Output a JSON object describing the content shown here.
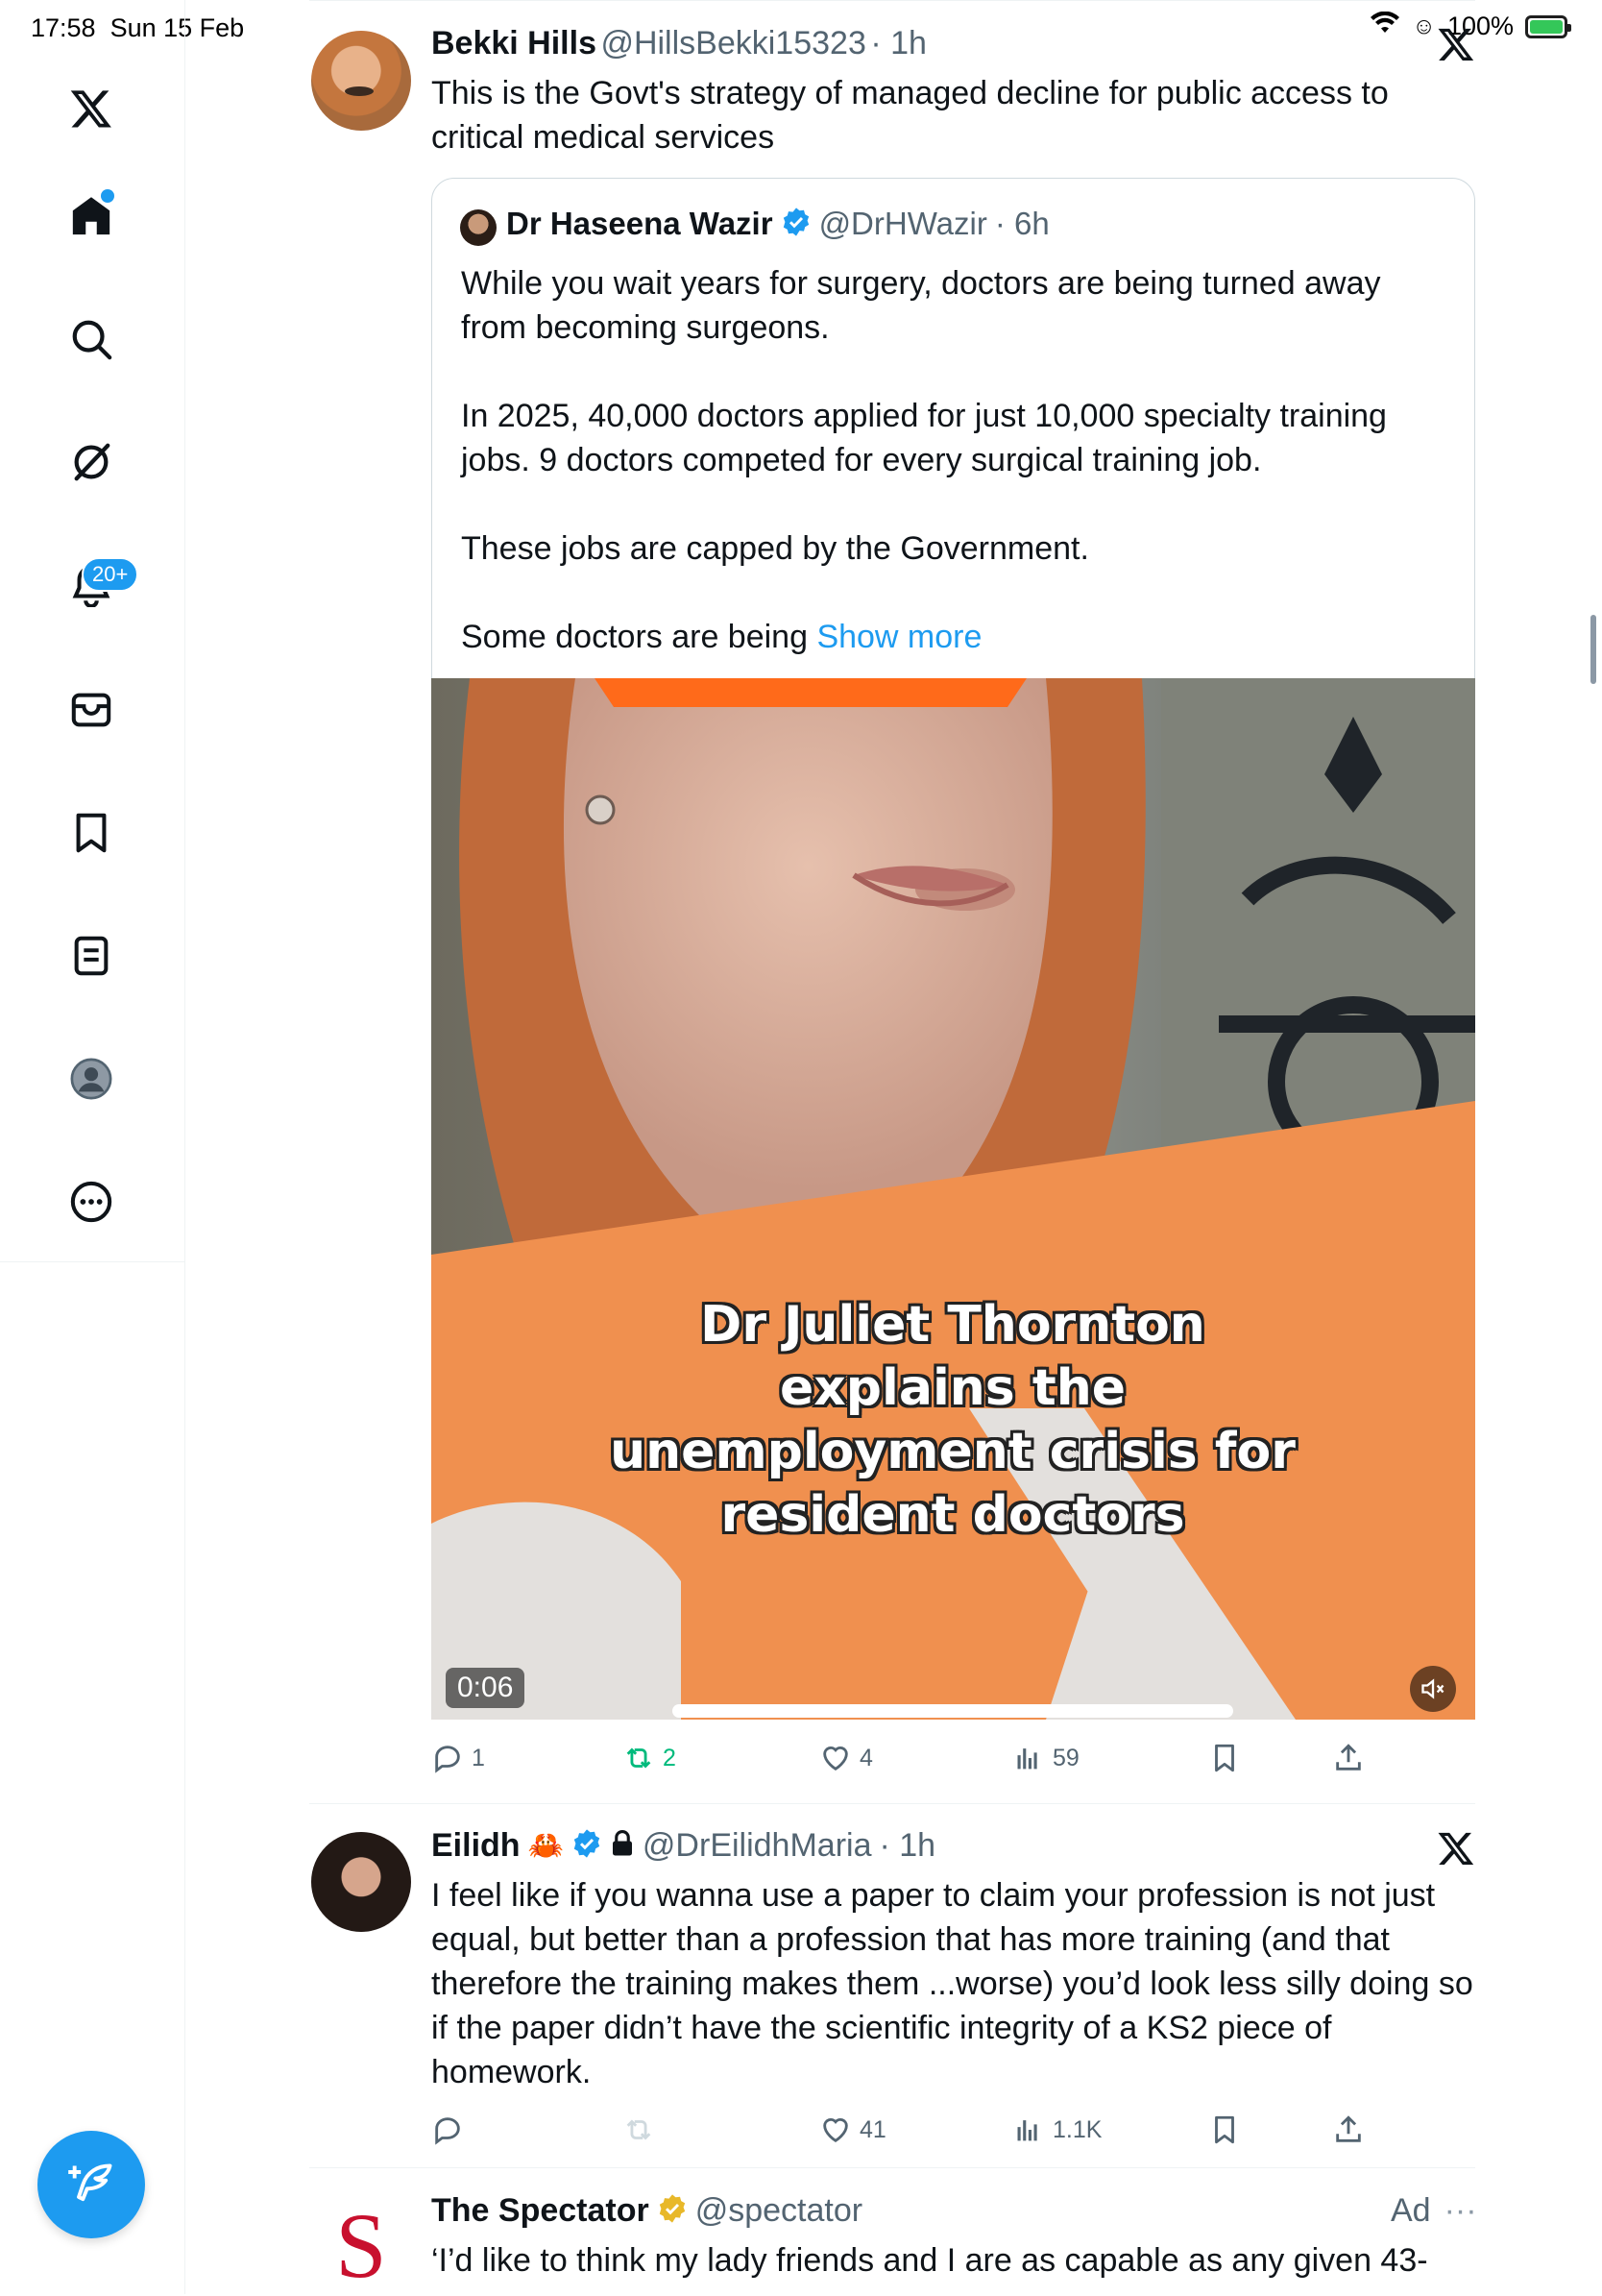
{
  "status_bar": {
    "time": "17:58",
    "date": "Sun 15 Feb",
    "battery": "100%"
  },
  "sidebar": {
    "items": [
      {
        "name": "x-logo-icon"
      },
      {
        "name": "home-icon"
      },
      {
        "name": "search-icon"
      },
      {
        "name": "grok-icon"
      },
      {
        "name": "notifications-icon",
        "badge": "20+"
      },
      {
        "name": "messages-icon"
      },
      {
        "name": "bookmarks-icon"
      },
      {
        "name": "lists-icon"
      },
      {
        "name": "profile-icon"
      },
      {
        "name": "more-icon"
      }
    ],
    "compose_icon": "compose-feather-icon"
  },
  "colors": {
    "accent": "#1d9bf0",
    "retweet_green": "#00ba7c",
    "verified_gold": "#e8b829",
    "text_primary": "#0f1419",
    "text_secondary": "#536471",
    "spectator_red": "#c8102e"
  },
  "tweets": [
    {
      "name": "Bekki Hills",
      "handle": "@HillsBekki15323",
      "time": "· 1h",
      "text": "This is the Govt's strategy of managed decline for public access to critical medical services",
      "quote": {
        "name": "Dr Haseena Wazir",
        "handle": "@DrHWazir",
        "time": "· 6h",
        "text": "While you wait years for surgery, doctors are being turned away from becoming surgeons.\n\nIn 2025, 40,000 doctors applied for just 10,000 specialty training jobs. 9 doctors competed for every surgical training job.\n\nThese jobs are capped by the Government.\n\nSome doctors are being ",
        "show_more": "Show more",
        "video": {
          "caption": "Dr Juliet Thornton\nexplains the\nunemployment crisis for\nresident doctors",
          "duration": "0:06"
        }
      },
      "stats": {
        "replies": "1",
        "reposts": "2",
        "likes": "4",
        "views": "59"
      }
    },
    {
      "name": "Eilidh",
      "emoji": "🦀",
      "handle": "@DrEilidhMaria",
      "time": "· 1h",
      "text": "I feel like if you wanna use a paper to claim your profession is not just equal, but better than a profession that has more training (and that therefore the training makes them ...worse) you’d look less silly doing so if the paper didn’t have the scientific integrity of a KS2 piece of homework.",
      "stats": {
        "replies": "",
        "reposts": "",
        "likes": "41",
        "views": "1.1K"
      }
    },
    {
      "name": "The Spectator",
      "handle": "@spectator",
      "ad_label": "Ad",
      "more": "···",
      "avatar_letter": "S",
      "text": "‘I’d like to think my lady friends and I are as capable as any given 43-"
    }
  ]
}
